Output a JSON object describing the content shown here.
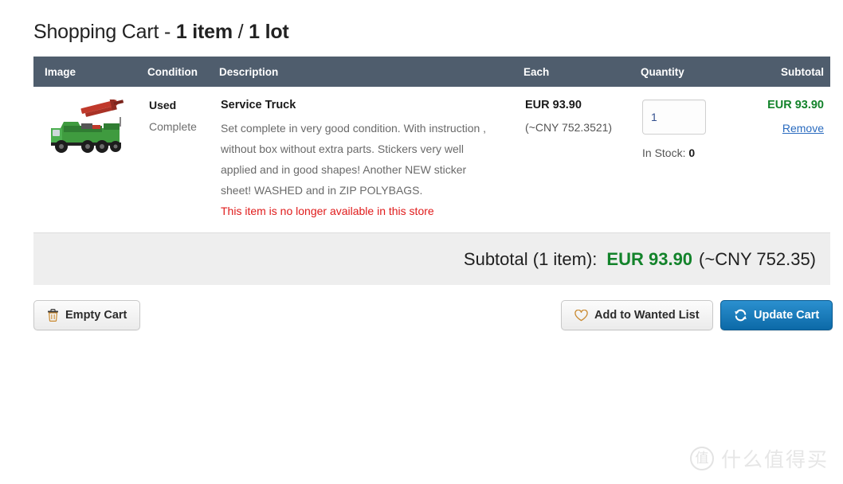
{
  "page": {
    "title_prefix": "Shopping Cart - ",
    "title_items": "1 item",
    "title_separator": " / ",
    "title_lots": "1 lot"
  },
  "colors": {
    "table_header_bg": "#4f5d6d",
    "price_green": "#13832b",
    "link_blue": "#2a6bbf",
    "warning_red": "#e01b1b",
    "primary_button": "#0c69a7",
    "subtotal_bar_bg": "#eeeeee"
  },
  "table": {
    "headers": {
      "image": "Image",
      "condition": "Condition",
      "description": "Description",
      "each": "Each",
      "quantity": "Quantity",
      "subtotal": "Subtotal"
    },
    "rows": [
      {
        "image_alt": "lego-service-truck-thumbnail",
        "condition_main": "Used",
        "condition_sub": "Complete",
        "title": " Service Truck",
        "description": "Set complete in very good condition. With instruction , without box without extra parts. Stickers very well applied and in good shapes! Another NEW sticker sheet! WASHED and in ZIP POLYBAGS.",
        "warning": "This item is no longer available in this store",
        "each_price": "EUR 93.90",
        "each_converted": "(~CNY 752.3521)",
        "quantity_value": "1",
        "stock_label": "In Stock: ",
        "stock_value": "0",
        "subtotal_price": "EUR 93.90",
        "remove_label": "Remove"
      }
    ]
  },
  "subtotal": {
    "label": "Subtotal (1 item):",
    "amount": "EUR 93.90",
    "converted": "(~CNY 752.35)"
  },
  "actions": {
    "empty_cart": "Empty Cart",
    "add_to_wanted_list": "Add to Wanted List",
    "update_cart": "Update Cart"
  },
  "watermark": {
    "mark": "值",
    "text": "什么值得买"
  }
}
